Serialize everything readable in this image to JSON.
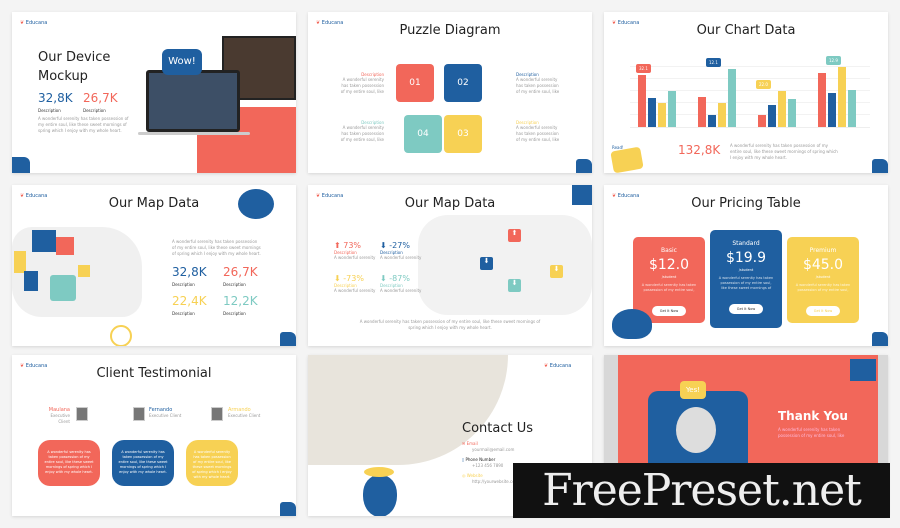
{
  "brand": "Educana",
  "colors": {
    "coral": "#f2675a",
    "blue": "#1f5fa0",
    "yellow": "#f7d154",
    "teal": "#7ecac2"
  },
  "desc_label": "Description",
  "lorem": "A wonderful serenity has taken possession of my entire soul, like these sweet mornings of spring which I enjoy with my whole heart.",
  "device": {
    "title_1": "Our Device",
    "title_2": "Mockup",
    "stat1": "32,8K",
    "stat2": "26,7K",
    "bubble": "Wow!"
  },
  "puzzle": {
    "title": "Puzzle Diagram",
    "pieces": [
      "01",
      "02",
      "04",
      "03"
    ]
  },
  "chart": {
    "title": "Our Chart Data",
    "total": "132,8K",
    "sticker": "Read!"
  },
  "chart_data": {
    "type": "bar",
    "categories": [
      "1",
      "2",
      "3",
      "4"
    ],
    "ylim": [
      0,
      6
    ],
    "grid": true,
    "series": [
      {
        "color": "#f2675a",
        "values": [
          4.3,
          2.5,
          1.0,
          4.5
        ]
      },
      {
        "color": "#1f5fa0",
        "values": [
          2.4,
          1.0,
          1.8,
          2.8
        ]
      },
      {
        "color": "#f7d154",
        "values": [
          2.0,
          2.0,
          3.0,
          5.0
        ]
      },
      {
        "color": "#7ecac2",
        "values": [
          3.0,
          4.8,
          2.3,
          3.1
        ]
      }
    ],
    "annotations": [
      "32.1",
      "12.1",
      "22.0",
      "12.9"
    ]
  },
  "map_us": {
    "title": "Our Map Data",
    "stats": [
      "32,8K",
      "26,7K",
      "22,4K",
      "12,2K"
    ]
  },
  "map_eu": {
    "title": "Our Map Data",
    "stats": [
      {
        "v": "73%",
        "dir": "up"
      },
      {
        "v": "-27%",
        "dir": "down"
      },
      {
        "v": "-73%",
        "dir": "down"
      },
      {
        "v": "-87%",
        "dir": "down"
      }
    ],
    "sub": "A wonderful serenity"
  },
  "pricing": {
    "title": "Our Pricing Table",
    "plans": [
      {
        "name": "Basic",
        "price": "$12.0",
        "per": "/student",
        "button": "Get It Now"
      },
      {
        "name": "Standard",
        "price": "$19.9",
        "per": "/student",
        "button": "Get It Now"
      },
      {
        "name": "Premium",
        "price": "$45.0",
        "per": "/student",
        "button": "Get It Now"
      }
    ]
  },
  "testimonial": {
    "title": "Client Testimonial",
    "people": [
      {
        "name": "Maulana",
        "role": "Executive Client"
      },
      {
        "name": "Fernando",
        "role": "Executive Client"
      },
      {
        "name": "Armando",
        "role": "Executive Client"
      }
    ]
  },
  "contact": {
    "title": "Contact Us",
    "items": [
      {
        "label": "Email",
        "value": "yourmail@email.com"
      },
      {
        "label": "Phone Number",
        "value": "+123 456 7890"
      },
      {
        "label": "Website",
        "value": "http://yourwebsite.com"
      }
    ]
  },
  "thanks": {
    "title": "Thank You",
    "bubble": "Yes!"
  },
  "watermark": "FreePreset.net"
}
